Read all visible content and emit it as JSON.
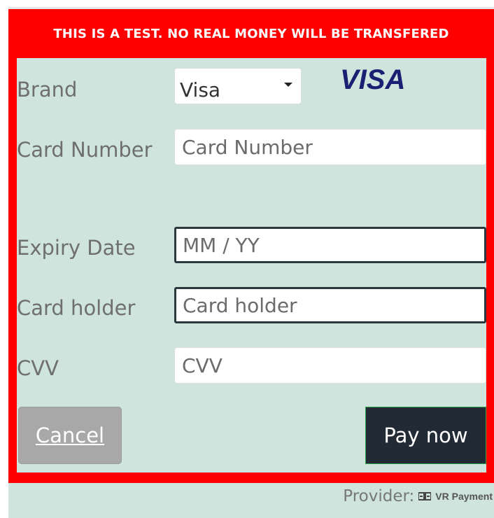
{
  "banner": {
    "text": "THIS IS A TEST. NO REAL MONEY WILL BE TRANSFERED"
  },
  "form": {
    "brand": {
      "label": "Brand",
      "selected": "Visa",
      "logo_text": "VISA",
      "logo_color": "#1a1f71"
    },
    "card_number": {
      "label": "Card Number",
      "placeholder": "Card Number"
    },
    "expiry": {
      "label": "Expiry Date",
      "placeholder": "MM / YY"
    },
    "card_holder": {
      "label": "Card holder",
      "placeholder": "Card holder"
    },
    "cvv": {
      "label": "CVV",
      "placeholder": "CVV"
    }
  },
  "actions": {
    "cancel_label": "Cancel",
    "pay_label": "Pay now"
  },
  "footer": {
    "provider_label": "Provider:",
    "provider_name": "VR Payment"
  },
  "colors": {
    "frame": "#ff0000",
    "form_background": "#cee4dd",
    "pay_button": "#222b35",
    "cancel_button": "#a8a8a8"
  }
}
